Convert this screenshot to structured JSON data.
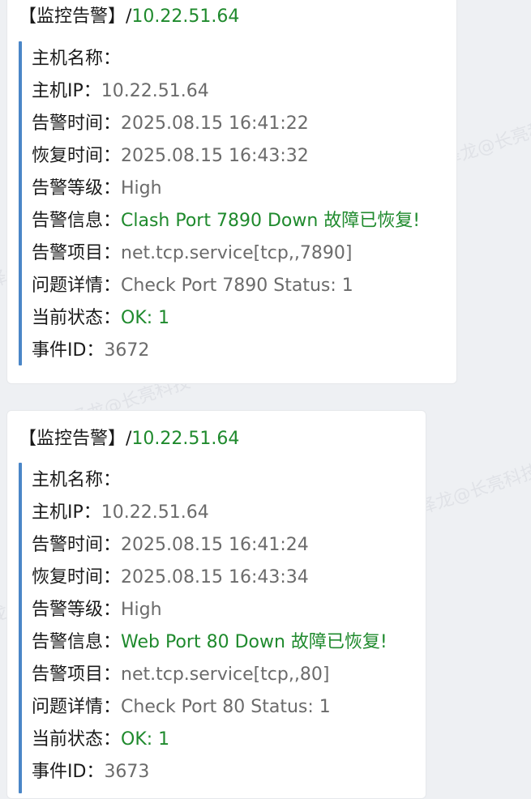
{
  "watermark": "洪泽龙@长亮科技 0629",
  "alerts": [
    {
      "title_prefix": "【监控告警】/",
      "title_host": "10.22.51.64",
      "fields": [
        {
          "label": "主机名称：",
          "value": ""
        },
        {
          "label": "主机IP：",
          "value": "10.22.51.64"
        },
        {
          "label": "告警时间：",
          "value": "2025.08.15 16:41:22"
        },
        {
          "label": "恢复时间：",
          "value": "2025.08.15 16:43:32"
        },
        {
          "label": "告警等级：",
          "value": "High"
        },
        {
          "label": "告警信息：",
          "value": "Clash Port 7890 Down 故障已恢复!"
        },
        {
          "label": "告警项目：",
          "value": "net.tcp.service[tcp,,7890]"
        },
        {
          "label": "问题详情：",
          "value": "Check Port 7890 Status: 1"
        },
        {
          "label": "当前状态：",
          "value": "OK: 1"
        },
        {
          "label": "事件ID：",
          "value": "3672"
        }
      ]
    },
    {
      "title_prefix": "【监控告警】/",
      "title_host": "10.22.51.64",
      "fields": [
        {
          "label": "主机名称：",
          "value": ""
        },
        {
          "label": "主机IP：",
          "value": "10.22.51.64"
        },
        {
          "label": "告警时间：",
          "value": "2025.08.15 16:41:24"
        },
        {
          "label": "恢复时间：",
          "value": "2025.08.15 16:43:34"
        },
        {
          "label": "告警等级：",
          "value": "High"
        },
        {
          "label": "告警信息：",
          "value": "Web Port 80 Down 故障已恢复!"
        },
        {
          "label": "告警项目：",
          "value": "net.tcp.service[tcp,,80]"
        },
        {
          "label": "问题详情：",
          "value": "Check Port 80 Status: 1"
        },
        {
          "label": "当前状态：",
          "value": "OK: 1"
        },
        {
          "label": "事件ID：",
          "value": "3673"
        }
      ]
    }
  ],
  "colors": {
    "green": "#1f8a2d",
    "quote_bar": "#4a86c7"
  }
}
